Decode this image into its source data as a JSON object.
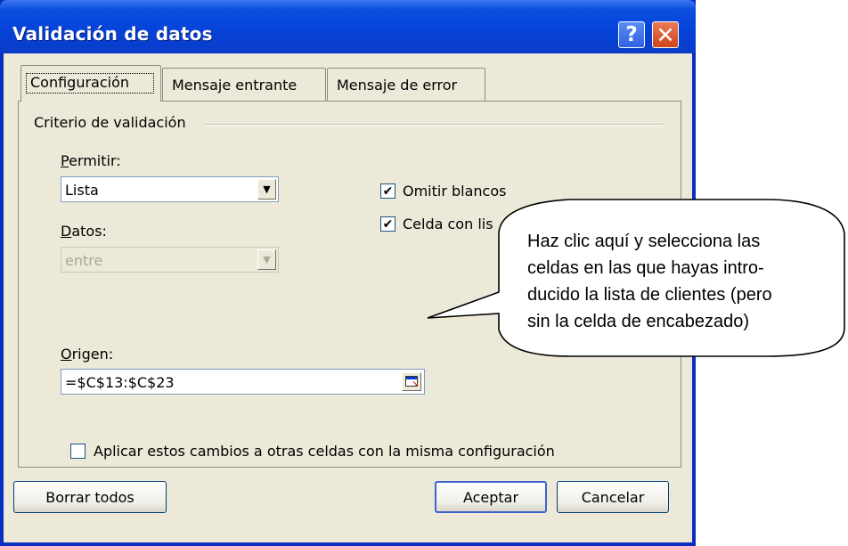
{
  "dialog": {
    "title": "Validación de datos",
    "help_glyph": "?",
    "close_glyph": "✕"
  },
  "tabs": [
    {
      "label": "Configuración"
    },
    {
      "label": "Mensaje entrante"
    },
    {
      "label": "Mensaje de error"
    }
  ],
  "criteria": {
    "group_label": "Criterio de validación",
    "permitir_label": "Permitir:",
    "permitir_value": "Lista",
    "datos_label": "Datos:",
    "datos_value": "entre",
    "origen_label": "Origen:",
    "origen_value": "=$C$13:$C$23",
    "omitir_label": "Omitir blancos",
    "omitir_checked": true,
    "celda_label": "Celda con lis",
    "celda_checked": true,
    "aplicar_label": "Aplicar estos cambios a otras celdas con la misma configuración",
    "aplicar_checked": false
  },
  "buttons": {
    "borrar": "Borrar todos",
    "aceptar": "Aceptar",
    "cancelar": "Cancelar"
  },
  "callout": {
    "lines": [
      "Haz clic aquí y selecciona las",
      "celdas en las que hayas intro-",
      "ducido la lista de clientes (pero",
      "sin la celda de encabezado)"
    ]
  },
  "icons": {
    "check": "✔",
    "dropdown": "▼"
  }
}
